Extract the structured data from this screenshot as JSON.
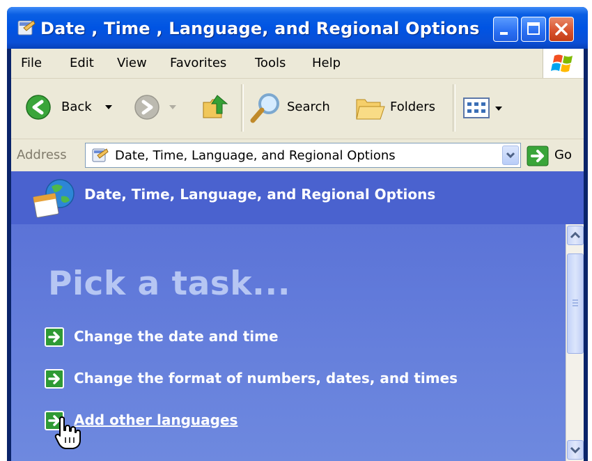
{
  "window": {
    "title": "Date , Time , Language, and Regional Options",
    "buttons": [
      "minimize",
      "maximize",
      "close"
    ],
    "accent_color": "#0054e3"
  },
  "menubar": {
    "items": [
      "File",
      "Edit",
      "View",
      "Favorites",
      "Tools",
      "Help"
    ]
  },
  "toolbar": {
    "back_label": "Back",
    "search_label": "Search",
    "folders_label": "Folders",
    "icons": [
      "back-icon",
      "forward-icon",
      "up-folder-icon",
      "search-icon",
      "folders-icon",
      "views-icon"
    ]
  },
  "addressbar": {
    "label": "Address",
    "value": "Date, Time, Language, and Regional Options",
    "go_label": "Go"
  },
  "content": {
    "banner_title": "Date, Time, Language, and Regional Options",
    "heading": "Pick a task...",
    "tasks": [
      "Change the date and time",
      "Change the format of numbers, dates, and times",
      "Add other languages"
    ],
    "hovered_task": "Add other languages",
    "background_color": "#6b86dc",
    "banner_color": "#4a62cf"
  }
}
